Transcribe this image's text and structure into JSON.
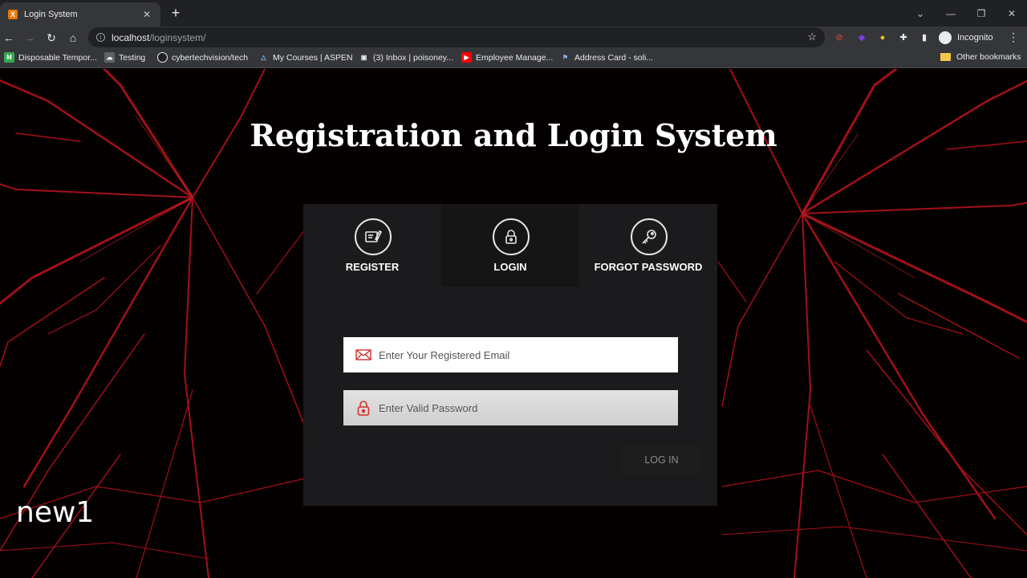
{
  "browser": {
    "tab_title": "Login System",
    "tab_favicon": "X",
    "url_host": "localhost",
    "url_path": "/loginsystem/",
    "profile_label": "Incognito",
    "bookmarks": [
      {
        "label": "Disposable Tempor...",
        "icon": "M",
        "color": "#34a853"
      },
      {
        "label": "Testing",
        "icon": "☁",
        "color": "#5f6368"
      },
      {
        "label": "cybertechvision/tech",
        "icon": "⊙",
        "color": "#202124"
      },
      {
        "label": "My Courses | ASPEN",
        "icon": "△",
        "color": "#35363a"
      },
      {
        "label": "(3) Inbox | poisoney...",
        "icon": "▣",
        "color": "#35363a"
      },
      {
        "label": "Employee Manage...",
        "icon": "▶",
        "color": "#ff0000"
      },
      {
        "label": "Address Card - soli...",
        "icon": "⚑",
        "color": "#35363a"
      }
    ],
    "other_bookmarks": "Other bookmarks"
  },
  "page": {
    "title": "Registration and Login System",
    "tabs": [
      {
        "label": "REGISTER",
        "icon": "register-icon"
      },
      {
        "label": "LOGIN",
        "icon": "lock-icon"
      },
      {
        "label": "FORGOT PASSWORD",
        "icon": "key-icon"
      }
    ],
    "active_tab": "LOGIN",
    "email_placeholder": "Enter Your Registered Email",
    "email_value": "",
    "password_placeholder": "Enter Valid Password",
    "password_value": "",
    "login_button": "LOG IN",
    "accent_color": "#d0312d"
  },
  "overlay_text": "new1"
}
